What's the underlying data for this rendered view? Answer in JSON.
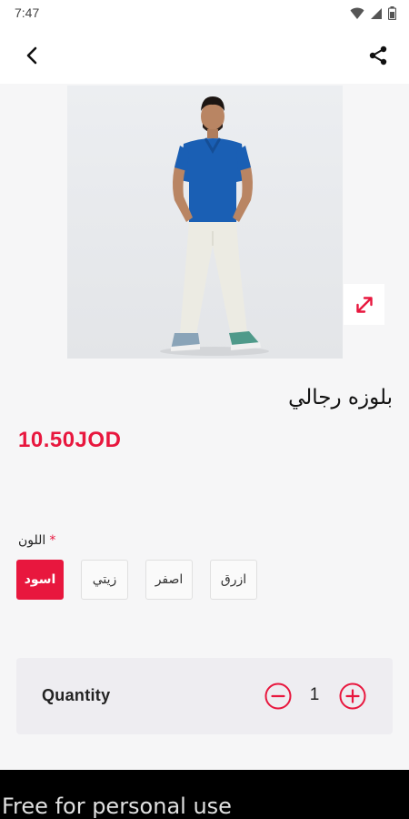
{
  "status_bar": {
    "time": "7:47",
    "icons": [
      "wifi-icon",
      "signal-icon",
      "battery-icon"
    ]
  },
  "app_bar": {
    "back_icon": "chevron-left-icon",
    "share_icon": "share-icon"
  },
  "product": {
    "image_icon": "product-photo",
    "expand_icon": "expand-icon",
    "title": "بلوزه رجالي",
    "price": "10.50JOD"
  },
  "color": {
    "required_mark": "*",
    "label": "اللون",
    "options": [
      {
        "label": "اسود",
        "selected": true
      },
      {
        "label": "زيتي",
        "selected": false
      },
      {
        "label": "اصفر",
        "selected": false
      },
      {
        "label": "ازرق",
        "selected": false
      }
    ]
  },
  "quantity": {
    "label": "Quantity",
    "value": "1"
  },
  "footer": {
    "text": "Free for personal use"
  },
  "colors": {
    "accent": "#e8173e",
    "background": "#f6f6f7",
    "shirt": "#1a5fb4"
  }
}
